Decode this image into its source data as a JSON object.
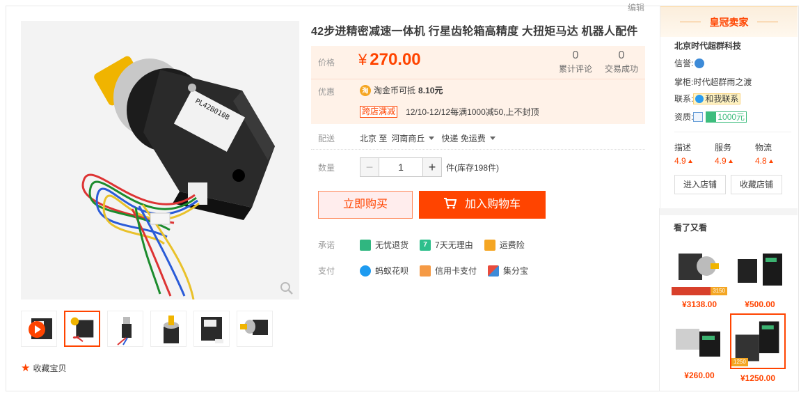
{
  "header": {
    "edit_label": "编辑"
  },
  "product": {
    "title": "42步进精密减速一体机 行星齿轮箱高精度 大扭矩马达 机器人配件",
    "thumb_label": "PL42B010B",
    "favorite_label": "收藏宝贝"
  },
  "price": {
    "label": "价格",
    "currency": "¥",
    "value": "270.00",
    "stats": [
      {
        "num": "0",
        "caption": "累计评论"
      },
      {
        "num": "0",
        "caption": "交易成功"
      }
    ]
  },
  "promo": {
    "label": "优惠",
    "coin_icon_text": "淘",
    "coin_text": "淘金币可抵",
    "coin_amount": "8.10元",
    "store_tag": "跨店满减",
    "store_text": "12/10-12/12每满1000减50,上不封顶"
  },
  "shipping": {
    "label": "配送",
    "from": "北京 至",
    "to": "河南商丘",
    "method": "快递 免运费"
  },
  "quantity": {
    "label": "数量",
    "value": "1",
    "minus": "−",
    "plus": "+",
    "stock_text": "件(库存198件)"
  },
  "actions": {
    "buy_now": "立即购买",
    "add_to_cart": "加入购物车"
  },
  "promise": {
    "label": "承诺",
    "items": [
      {
        "icon": "truck-icon",
        "text": "无忧退货",
        "color": "#30b680"
      },
      {
        "icon": "seven-day-icon",
        "text": "7天无理由",
        "color": "#2ebf8c"
      },
      {
        "icon": "insurance-icon",
        "text": "运费险",
        "color": "#f5a623"
      }
    ]
  },
  "payment": {
    "label": "支付",
    "items": [
      {
        "icon": "huabei-icon",
        "text": "蚂蚁花呗",
        "color": "#1e9bf0"
      },
      {
        "icon": "credit-card-icon",
        "text": "信用卡支付",
        "color": "#f59a45"
      },
      {
        "icon": "jifenbao-icon",
        "text": "集分宝",
        "color": "#e94b3c"
      }
    ]
  },
  "seller": {
    "crown_title": "皇冠卖家",
    "shop_name": "北京时代超群科技",
    "credit_label": "信誉:",
    "keeper_label": "掌柜:",
    "keeper_name": "时代超群雨之渡",
    "contact_label": "联系:",
    "contact_text": "和我联系",
    "qual_label": "资质:",
    "deposit_text": "1000元",
    "scores": [
      {
        "name": "描述",
        "value": "4.9"
      },
      {
        "name": "服务",
        "value": "4.9"
      },
      {
        "name": "物流",
        "value": "4.8"
      }
    ],
    "enter_shop": "进入店铺",
    "follow_shop": "收藏店铺"
  },
  "also_viewed": {
    "title": "看了又看",
    "items": [
      {
        "price": "¥3138.00",
        "tag": "3150"
      },
      {
        "price": "¥500.00"
      },
      {
        "price": "¥260.00"
      },
      {
        "price": "¥1250.00",
        "tag": "1250"
      }
    ]
  },
  "colors": {
    "accent": "#ff4400",
    "price_bg": "#fff2e8",
    "cart": "#ff4400",
    "buy_bg": "#ffeded"
  }
}
